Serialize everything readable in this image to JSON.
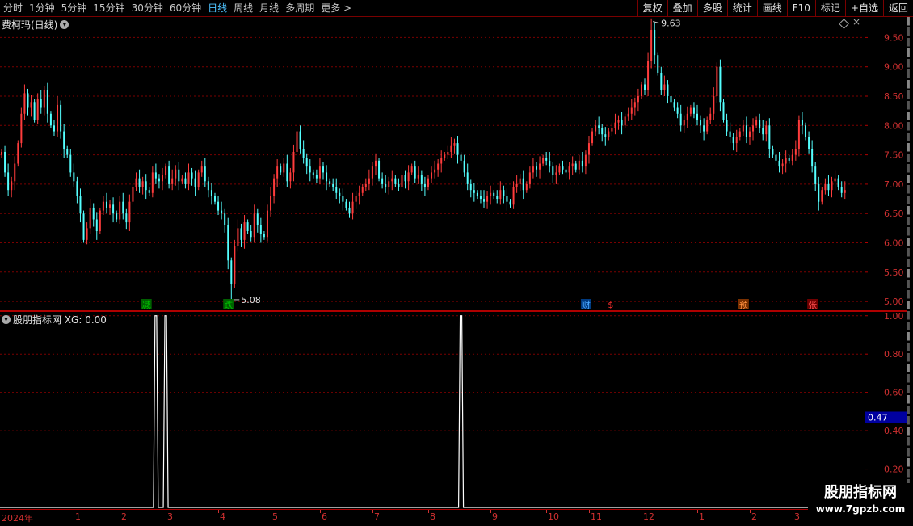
{
  "toolbar": {
    "periods": [
      "分时",
      "1分钟",
      "5分钟",
      "15分钟",
      "30分钟",
      "60分钟",
      "日线",
      "周线",
      "月线",
      "多周期",
      "更多 >"
    ],
    "active_index": 6,
    "buttons": [
      "复权",
      "叠加",
      "多股",
      "统计",
      "画线",
      "F10",
      "标记",
      "+自选",
      "返回"
    ]
  },
  "main": {
    "title": "费柯玛(日线)",
    "high_label": "9.63",
    "low_label": "5.08",
    "event_markers": [
      {
        "label": "减",
        "idx": 44,
        "color": "#00c000",
        "bg": "#006000"
      },
      {
        "label": "跌",
        "idx": 69,
        "color": "#00c000",
        "bg": "#006000"
      },
      {
        "label": "财",
        "idx": 178,
        "color": "#4aa8ff",
        "bg": "#003a80"
      },
      {
        "label": "$",
        "idx": 186,
        "color": "#ff3030",
        "bg": "none"
      },
      {
        "label": "预",
        "idx": 226,
        "color": "#ff9040",
        "bg": "#7a3000"
      },
      {
        "label": "张",
        "idx": 247,
        "color": "#ff5050",
        "bg": "#700000"
      }
    ]
  },
  "indicator": {
    "title": "股朋指标网 XG: 0.00",
    "current_value": "0.47"
  },
  "chart_data": [
    {
      "type": "candlestick",
      "title": "费柯玛(日线)",
      "y_ticks": [
        "5.00",
        "5.50",
        "6.00",
        "6.50",
        "7.00",
        "7.50",
        "8.00",
        "8.50",
        "9.00",
        "9.50"
      ],
      "ylim": [
        4.85,
        9.85
      ],
      "x_labels": [
        "2024年",
        "1",
        "2",
        "3",
        "4",
        "5",
        "6",
        "7",
        "8",
        "9",
        "10",
        "11",
        "12",
        "1",
        "2",
        "3"
      ],
      "x_label_idx": [
        0,
        22,
        36,
        50,
        66,
        82,
        97,
        113,
        130,
        149,
        166,
        179,
        195,
        212,
        228,
        241
      ],
      "num_bars": 262,
      "closes": [
        7.55,
        7.2,
        6.9,
        7.05,
        7.35,
        7.7,
        8.2,
        8.55,
        8.3,
        8.4,
        8.1,
        8.45,
        8.3,
        8.6,
        8.2,
        8.0,
        7.9,
        8.35,
        7.9,
        7.6,
        7.5,
        7.2,
        7.05,
        6.8,
        6.5,
        6.05,
        6.25,
        6.6,
        6.4,
        6.2,
        6.55,
        6.7,
        6.6,
        6.65,
        6.5,
        6.4,
        6.7,
        6.5,
        6.35,
        6.7,
        6.95,
        7.1,
        6.95,
        7.05,
        6.9,
        6.85,
        7.2,
        7.1,
        7.05,
        7.15,
        7.3,
        7.0,
        7.1,
        7.25,
        7.05,
        7.1,
        7.0,
        7.2,
        7.1,
        6.95,
        7.2,
        7.3,
        7.05,
        6.9,
        6.8,
        6.7,
        6.55,
        6.5,
        6.3,
        5.7,
        5.3,
        5.95,
        6.25,
        6.05,
        6.35,
        6.2,
        6.1,
        6.5,
        6.3,
        6.15,
        6.1,
        6.55,
        6.8,
        7.1,
        7.3,
        7.2,
        7.35,
        7.05,
        7.2,
        7.55,
        7.9,
        7.6,
        7.45,
        7.3,
        7.2,
        7.15,
        7.1,
        7.3,
        7.2,
        7.05,
        7.0,
        6.95,
        6.85,
        6.8,
        6.7,
        6.6,
        6.5,
        6.7,
        6.8,
        6.85,
        6.95,
        7.0,
        7.1,
        7.3,
        7.4,
        7.1,
        7.0,
        6.95,
        7.05,
        7.1,
        7.0,
        6.95,
        7.15,
        7.05,
        7.2,
        7.3,
        7.1,
        7.15,
        7.0,
        6.95,
        7.1,
        7.2,
        7.25,
        7.35,
        7.45,
        7.5,
        7.55,
        7.65,
        7.7,
        7.5,
        7.4,
        7.2,
        7.0,
        6.9,
        6.85,
        6.8,
        6.75,
        6.7,
        6.8,
        6.85,
        6.8,
        6.75,
        6.9,
        6.8,
        6.7,
        6.65,
        6.95,
        7.0,
        7.1,
        6.9,
        7.0,
        7.2,
        7.3,
        7.25,
        7.35,
        7.45,
        7.4,
        7.3,
        7.15,
        7.2,
        7.3,
        7.25,
        7.2,
        7.3,
        7.35,
        7.25,
        7.4,
        7.3,
        7.5,
        7.7,
        7.9,
        8.0,
        7.95,
        7.85,
        7.8,
        7.9,
        7.95,
        8.05,
        8.1,
        8.0,
        8.15,
        8.2,
        8.3,
        8.4,
        8.5,
        8.7,
        8.6,
        9.1,
        9.63,
        9.2,
        8.9,
        8.6,
        8.7,
        8.5,
        8.4,
        8.3,
        8.2,
        8.0,
        8.1,
        8.2,
        8.3,
        8.2,
        8.1,
        8.0,
        7.9,
        8.1,
        8.2,
        8.5,
        9.0,
        8.4,
        8.1,
        7.9,
        7.8,
        7.7,
        7.8,
        7.9,
        8.0,
        7.8,
        7.9,
        8.0,
        8.1,
        7.95,
        7.85,
        8.0,
        7.6,
        7.5,
        7.4,
        7.3,
        7.35,
        7.45,
        7.4,
        7.5,
        7.6,
        8.1,
        8.0,
        7.8,
        7.6,
        7.3,
        7.0,
        6.7,
        6.9,
        7.0,
        6.9,
        7.05,
        7.1,
        6.95,
        6.85,
        6.9
      ],
      "series_colors": {
        "up": "#ff3c3c",
        "down": "#54ffff"
      }
    },
    {
      "type": "line",
      "title": "股朋指标网 XG: 0.00",
      "series": [
        {
          "name": "XG",
          "pulses_at_bar_index": [
            47,
            50,
            140
          ]
        }
      ],
      "y_ticks": [
        "0.20",
        "0.40",
        "0.60",
        "0.80",
        "1.00"
      ],
      "ylim": [
        0,
        1.02
      ]
    }
  ]
}
